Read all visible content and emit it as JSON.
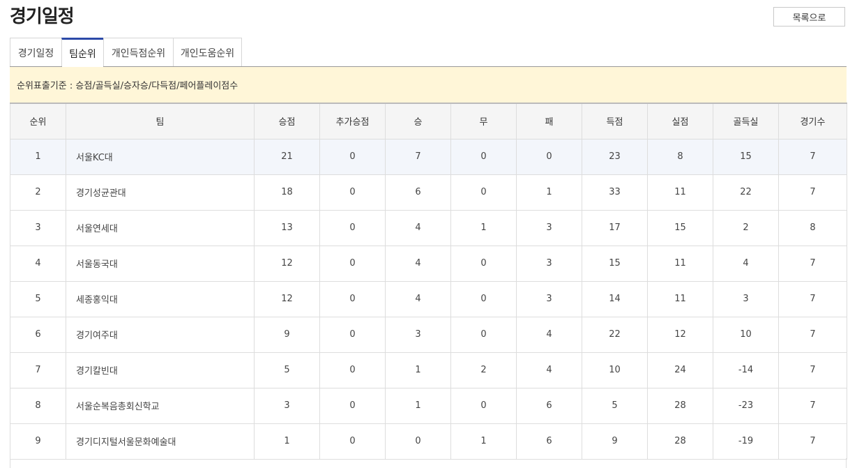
{
  "page": {
    "title": "경기일정",
    "list_button_label": "목록으로"
  },
  "tabs": [
    {
      "label": "경기일정",
      "active": false
    },
    {
      "label": "팀순위",
      "active": true
    },
    {
      "label": "개인득점순위",
      "active": false
    },
    {
      "label": "개인도움순위",
      "active": false
    }
  ],
  "notice": {
    "text": "순위표출기준 : 승점/골득실/승자승/다득점/페어플레이점수"
  },
  "table": {
    "headers": [
      "순위",
      "팀",
      "승점",
      "추가승점",
      "승",
      "무",
      "패",
      "득점",
      "실점",
      "골득실",
      "경기수"
    ],
    "rows": [
      [
        "1",
        "서울KC대",
        "21",
        "0",
        "7",
        "0",
        "0",
        "23",
        "8",
        "15",
        "7"
      ],
      [
        "2",
        "경기성균관대",
        "18",
        "0",
        "6",
        "0",
        "1",
        "33",
        "11",
        "22",
        "7"
      ],
      [
        "3",
        "서울연세대",
        "13",
        "0",
        "4",
        "1",
        "3",
        "17",
        "15",
        "2",
        "8"
      ],
      [
        "4",
        "서울동국대",
        "12",
        "0",
        "4",
        "0",
        "3",
        "15",
        "11",
        "4",
        "7"
      ],
      [
        "5",
        "세종홍익대",
        "12",
        "0",
        "4",
        "0",
        "3",
        "14",
        "11",
        "3",
        "7"
      ],
      [
        "6",
        "경기여주대",
        "9",
        "0",
        "3",
        "0",
        "4",
        "22",
        "12",
        "10",
        "7"
      ],
      [
        "7",
        "경기칼빈대",
        "5",
        "0",
        "1",
        "2",
        "4",
        "10",
        "24",
        "-14",
        "7"
      ],
      [
        "8",
        "서울순복음총회신학교",
        "3",
        "0",
        "1",
        "0",
        "6",
        "5",
        "28",
        "-23",
        "7"
      ],
      [
        "9",
        "경기디지털서울문화예술대",
        "1",
        "0",
        "0",
        "1",
        "6",
        "9",
        "28",
        "-19",
        "7"
      ]
    ]
  },
  "colors": {
    "tab_active_border": "#2c4aa8",
    "notice_background": "#fff6d8",
    "header_background": "#f5f5f5",
    "highlight_row": "#f3f6fb"
  }
}
